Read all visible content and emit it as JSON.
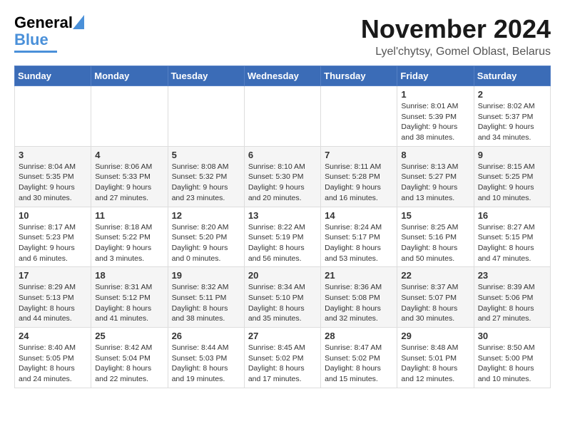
{
  "logo": {
    "general": "General",
    "blue": "Blue"
  },
  "title": {
    "month_year": "November 2024",
    "location": "Lyel'chytsy, Gomel Oblast, Belarus"
  },
  "weekdays": [
    "Sunday",
    "Monday",
    "Tuesday",
    "Wednesday",
    "Thursday",
    "Friday",
    "Saturday"
  ],
  "weeks": [
    [
      {
        "day": "",
        "info": ""
      },
      {
        "day": "",
        "info": ""
      },
      {
        "day": "",
        "info": ""
      },
      {
        "day": "",
        "info": ""
      },
      {
        "day": "",
        "info": ""
      },
      {
        "day": "1",
        "info": "Sunrise: 8:01 AM\nSunset: 5:39 PM\nDaylight: 9 hours\nand 38 minutes."
      },
      {
        "day": "2",
        "info": "Sunrise: 8:02 AM\nSunset: 5:37 PM\nDaylight: 9 hours\nand 34 minutes."
      }
    ],
    [
      {
        "day": "3",
        "info": "Sunrise: 8:04 AM\nSunset: 5:35 PM\nDaylight: 9 hours\nand 30 minutes."
      },
      {
        "day": "4",
        "info": "Sunrise: 8:06 AM\nSunset: 5:33 PM\nDaylight: 9 hours\nand 27 minutes."
      },
      {
        "day": "5",
        "info": "Sunrise: 8:08 AM\nSunset: 5:32 PM\nDaylight: 9 hours\nand 23 minutes."
      },
      {
        "day": "6",
        "info": "Sunrise: 8:10 AM\nSunset: 5:30 PM\nDaylight: 9 hours\nand 20 minutes."
      },
      {
        "day": "7",
        "info": "Sunrise: 8:11 AM\nSunset: 5:28 PM\nDaylight: 9 hours\nand 16 minutes."
      },
      {
        "day": "8",
        "info": "Sunrise: 8:13 AM\nSunset: 5:27 PM\nDaylight: 9 hours\nand 13 minutes."
      },
      {
        "day": "9",
        "info": "Sunrise: 8:15 AM\nSunset: 5:25 PM\nDaylight: 9 hours\nand 10 minutes."
      }
    ],
    [
      {
        "day": "10",
        "info": "Sunrise: 8:17 AM\nSunset: 5:23 PM\nDaylight: 9 hours\nand 6 minutes."
      },
      {
        "day": "11",
        "info": "Sunrise: 8:18 AM\nSunset: 5:22 PM\nDaylight: 9 hours\nand 3 minutes."
      },
      {
        "day": "12",
        "info": "Sunrise: 8:20 AM\nSunset: 5:20 PM\nDaylight: 9 hours\nand 0 minutes."
      },
      {
        "day": "13",
        "info": "Sunrise: 8:22 AM\nSunset: 5:19 PM\nDaylight: 8 hours\nand 56 minutes."
      },
      {
        "day": "14",
        "info": "Sunrise: 8:24 AM\nSunset: 5:17 PM\nDaylight: 8 hours\nand 53 minutes."
      },
      {
        "day": "15",
        "info": "Sunrise: 8:25 AM\nSunset: 5:16 PM\nDaylight: 8 hours\nand 50 minutes."
      },
      {
        "day": "16",
        "info": "Sunrise: 8:27 AM\nSunset: 5:15 PM\nDaylight: 8 hours\nand 47 minutes."
      }
    ],
    [
      {
        "day": "17",
        "info": "Sunrise: 8:29 AM\nSunset: 5:13 PM\nDaylight: 8 hours\nand 44 minutes."
      },
      {
        "day": "18",
        "info": "Sunrise: 8:31 AM\nSunset: 5:12 PM\nDaylight: 8 hours\nand 41 minutes."
      },
      {
        "day": "19",
        "info": "Sunrise: 8:32 AM\nSunset: 5:11 PM\nDaylight: 8 hours\nand 38 minutes."
      },
      {
        "day": "20",
        "info": "Sunrise: 8:34 AM\nSunset: 5:10 PM\nDaylight: 8 hours\nand 35 minutes."
      },
      {
        "day": "21",
        "info": "Sunrise: 8:36 AM\nSunset: 5:08 PM\nDaylight: 8 hours\nand 32 minutes."
      },
      {
        "day": "22",
        "info": "Sunrise: 8:37 AM\nSunset: 5:07 PM\nDaylight: 8 hours\nand 30 minutes."
      },
      {
        "day": "23",
        "info": "Sunrise: 8:39 AM\nSunset: 5:06 PM\nDaylight: 8 hours\nand 27 minutes."
      }
    ],
    [
      {
        "day": "24",
        "info": "Sunrise: 8:40 AM\nSunset: 5:05 PM\nDaylight: 8 hours\nand 24 minutes."
      },
      {
        "day": "25",
        "info": "Sunrise: 8:42 AM\nSunset: 5:04 PM\nDaylight: 8 hours\nand 22 minutes."
      },
      {
        "day": "26",
        "info": "Sunrise: 8:44 AM\nSunset: 5:03 PM\nDaylight: 8 hours\nand 19 minutes."
      },
      {
        "day": "27",
        "info": "Sunrise: 8:45 AM\nSunset: 5:02 PM\nDaylight: 8 hours\nand 17 minutes."
      },
      {
        "day": "28",
        "info": "Sunrise: 8:47 AM\nSunset: 5:02 PM\nDaylight: 8 hours\nand 15 minutes."
      },
      {
        "day": "29",
        "info": "Sunrise: 8:48 AM\nSunset: 5:01 PM\nDaylight: 8 hours\nand 12 minutes."
      },
      {
        "day": "30",
        "info": "Sunrise: 8:50 AM\nSunset: 5:00 PM\nDaylight: 8 hours\nand 10 minutes."
      }
    ]
  ]
}
